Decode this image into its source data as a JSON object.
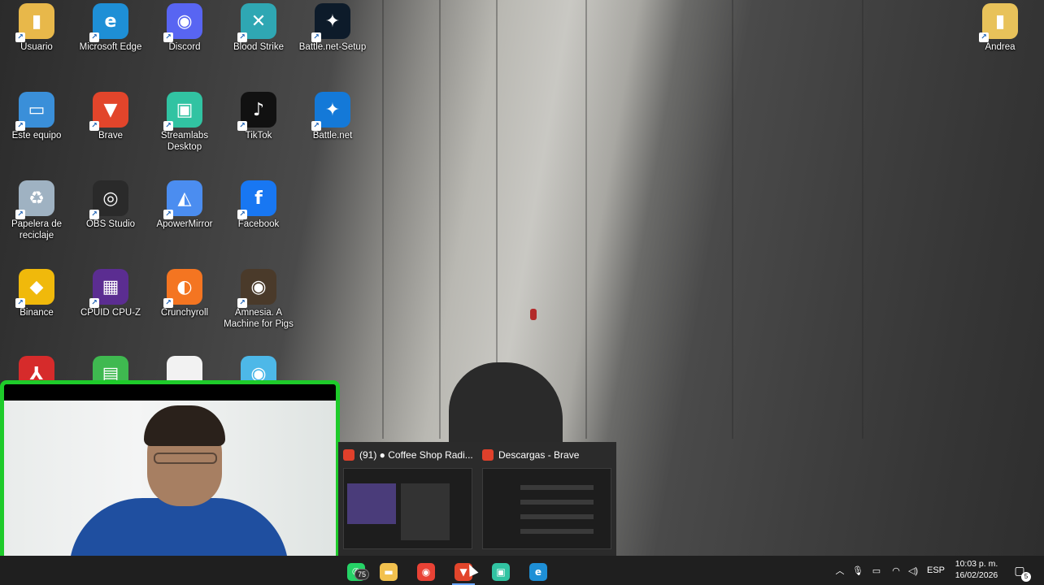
{
  "desktop": {
    "icons": [
      {
        "label": "Usuario",
        "icon": "user-folder-icon",
        "color": "#e8b84a",
        "glyph": "▮"
      },
      {
        "label": "Microsoft Edge",
        "icon": "edge-icon",
        "color": "#1e8fd6",
        "glyph": "e"
      },
      {
        "label": "Discord",
        "icon": "discord-icon",
        "color": "#5865f2",
        "glyph": "◉"
      },
      {
        "label": "Blood Strike",
        "icon": "blood-strike-icon",
        "color": "#2fa7b3",
        "glyph": "✕"
      },
      {
        "label": "Battle.net-Setup",
        "icon": "battlenet-setup-icon",
        "color": "#0d1b2a",
        "glyph": "✦"
      },
      {
        "label": "Este equipo",
        "icon": "this-pc-icon",
        "color": "#3a8fd9",
        "glyph": "▭"
      },
      {
        "label": "Brave",
        "icon": "brave-icon",
        "color": "#e2452b",
        "glyph": "▼"
      },
      {
        "label": "Streamlabs Desktop",
        "icon": "streamlabs-icon",
        "color": "#31c3a2",
        "glyph": "▣"
      },
      {
        "label": "TikTok",
        "icon": "tiktok-icon",
        "color": "#111111",
        "glyph": "♪"
      },
      {
        "label": "Battle.net",
        "icon": "battlenet-icon",
        "color": "#1479d8",
        "glyph": "✦"
      },
      {
        "label": "Papelera de reciclaje",
        "icon": "recycle-bin-icon",
        "color": "#9fb2c2",
        "glyph": "♻"
      },
      {
        "label": "OBS Studio",
        "icon": "obs-icon",
        "color": "#2a2a2a",
        "glyph": "◎"
      },
      {
        "label": "ApowerMirror",
        "icon": "apowermirror-icon",
        "color": "#4b8df0",
        "glyph": "◭"
      },
      {
        "label": "Facebook",
        "icon": "facebook-icon",
        "color": "#1877f2",
        "glyph": "f"
      },
      {
        "label": "Binance",
        "icon": "binance-icon",
        "color": "#f0b90b",
        "glyph": "◆"
      },
      {
        "label": "CPUID CPU-Z",
        "icon": "cpuz-icon",
        "color": "#5b2d91",
        "glyph": "▦"
      },
      {
        "label": "Crunchyroll",
        "icon": "crunchyroll-icon",
        "color": "#f47521",
        "glyph": "◐"
      },
      {
        "label": "Amnesia. A Machine for Pigs",
        "icon": "amnesia-icon",
        "color": "#4a3a2a",
        "glyph": "◉"
      },
      {
        "label": "",
        "icon": "adobe-pdf-icon",
        "color": "#d62b2b",
        "glyph": "⅄"
      },
      {
        "label": "",
        "icon": "green-app-icon",
        "color": "#3fb950",
        "glyph": "▤"
      },
      {
        "label": "",
        "icon": "blank-file-icon",
        "color": "#f2f2f2",
        "glyph": ""
      },
      {
        "label": "",
        "icon": "camera-app-icon",
        "color": "#4db8e8",
        "glyph": "◉"
      },
      {
        "label": "Andrea",
        "icon": "folder-icon",
        "color": "#e8c25a",
        "glyph": "▮"
      }
    ]
  },
  "thumbnails": [
    {
      "title": "(91) ● Coffee Shop Radi...",
      "icon": "youtube-tab-icon"
    },
    {
      "title": "Descargas - Brave",
      "icon": "brave-icon"
    }
  ],
  "taskbar": {
    "apps": [
      {
        "name": "whatsapp",
        "icon": "whatsapp-icon",
        "color": "#25d366",
        "glyph": "✆",
        "active": false
      },
      {
        "name": "file-explorer",
        "icon": "folder-icon",
        "color": "#f2c14e",
        "glyph": "▬",
        "active": false
      },
      {
        "name": "chrome",
        "icon": "chrome-icon",
        "color": "#e94235",
        "glyph": "◉",
        "active": false
      },
      {
        "name": "brave",
        "icon": "brave-icon",
        "color": "#e2452b",
        "glyph": "▼",
        "active": true
      },
      {
        "name": "streamlabs",
        "icon": "streamlabs-icon",
        "color": "#31c3a2",
        "glyph": "▣",
        "active": false
      },
      {
        "name": "edge",
        "icon": "edge-icon",
        "color": "#1e8fd6",
        "glyph": "e",
        "active": false
      }
    ],
    "whatsapp_badge": "75",
    "language": "ESP",
    "time": "10:03 p. m.",
    "date": "16/02/2026",
    "notification_count": "5"
  }
}
